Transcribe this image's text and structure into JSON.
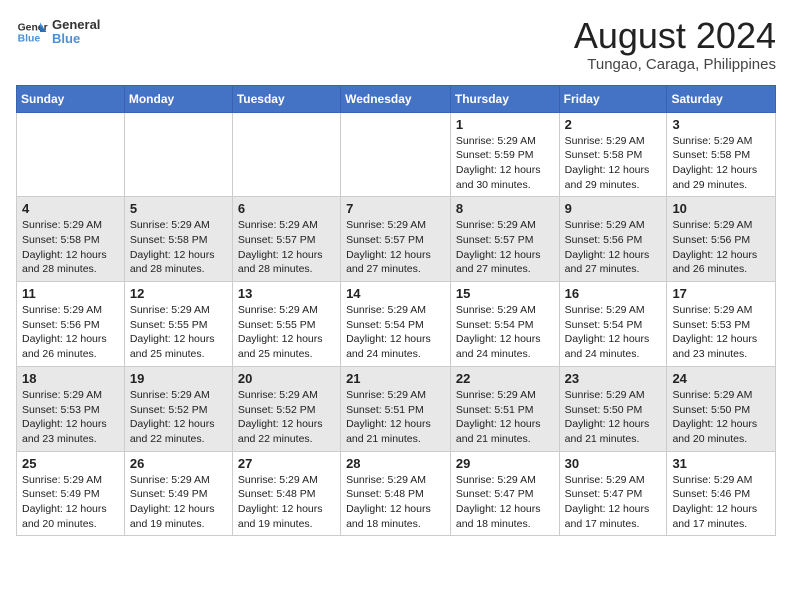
{
  "header": {
    "logo_general": "General",
    "logo_blue": "Blue",
    "title": "August 2024",
    "subtitle": "Tungao, Caraga, Philippines"
  },
  "weekdays": [
    "Sunday",
    "Monday",
    "Tuesday",
    "Wednesday",
    "Thursday",
    "Friday",
    "Saturday"
  ],
  "weeks": [
    [
      {
        "day": "",
        "info": ""
      },
      {
        "day": "",
        "info": ""
      },
      {
        "day": "",
        "info": ""
      },
      {
        "day": "",
        "info": ""
      },
      {
        "day": "1",
        "info": "Sunrise: 5:29 AM\nSunset: 5:59 PM\nDaylight: 12 hours and 30 minutes."
      },
      {
        "day": "2",
        "info": "Sunrise: 5:29 AM\nSunset: 5:58 PM\nDaylight: 12 hours and 29 minutes."
      },
      {
        "day": "3",
        "info": "Sunrise: 5:29 AM\nSunset: 5:58 PM\nDaylight: 12 hours and 29 minutes."
      }
    ],
    [
      {
        "day": "4",
        "info": "Sunrise: 5:29 AM\nSunset: 5:58 PM\nDaylight: 12 hours and 28 minutes."
      },
      {
        "day": "5",
        "info": "Sunrise: 5:29 AM\nSunset: 5:58 PM\nDaylight: 12 hours and 28 minutes."
      },
      {
        "day": "6",
        "info": "Sunrise: 5:29 AM\nSunset: 5:57 PM\nDaylight: 12 hours and 28 minutes."
      },
      {
        "day": "7",
        "info": "Sunrise: 5:29 AM\nSunset: 5:57 PM\nDaylight: 12 hours and 27 minutes."
      },
      {
        "day": "8",
        "info": "Sunrise: 5:29 AM\nSunset: 5:57 PM\nDaylight: 12 hours and 27 minutes."
      },
      {
        "day": "9",
        "info": "Sunrise: 5:29 AM\nSunset: 5:56 PM\nDaylight: 12 hours and 27 minutes."
      },
      {
        "day": "10",
        "info": "Sunrise: 5:29 AM\nSunset: 5:56 PM\nDaylight: 12 hours and 26 minutes."
      }
    ],
    [
      {
        "day": "11",
        "info": "Sunrise: 5:29 AM\nSunset: 5:56 PM\nDaylight: 12 hours and 26 minutes."
      },
      {
        "day": "12",
        "info": "Sunrise: 5:29 AM\nSunset: 5:55 PM\nDaylight: 12 hours and 25 minutes."
      },
      {
        "day": "13",
        "info": "Sunrise: 5:29 AM\nSunset: 5:55 PM\nDaylight: 12 hours and 25 minutes."
      },
      {
        "day": "14",
        "info": "Sunrise: 5:29 AM\nSunset: 5:54 PM\nDaylight: 12 hours and 24 minutes."
      },
      {
        "day": "15",
        "info": "Sunrise: 5:29 AM\nSunset: 5:54 PM\nDaylight: 12 hours and 24 minutes."
      },
      {
        "day": "16",
        "info": "Sunrise: 5:29 AM\nSunset: 5:54 PM\nDaylight: 12 hours and 24 minutes."
      },
      {
        "day": "17",
        "info": "Sunrise: 5:29 AM\nSunset: 5:53 PM\nDaylight: 12 hours and 23 minutes."
      }
    ],
    [
      {
        "day": "18",
        "info": "Sunrise: 5:29 AM\nSunset: 5:53 PM\nDaylight: 12 hours and 23 minutes."
      },
      {
        "day": "19",
        "info": "Sunrise: 5:29 AM\nSunset: 5:52 PM\nDaylight: 12 hours and 22 minutes."
      },
      {
        "day": "20",
        "info": "Sunrise: 5:29 AM\nSunset: 5:52 PM\nDaylight: 12 hours and 22 minutes."
      },
      {
        "day": "21",
        "info": "Sunrise: 5:29 AM\nSunset: 5:51 PM\nDaylight: 12 hours and 21 minutes."
      },
      {
        "day": "22",
        "info": "Sunrise: 5:29 AM\nSunset: 5:51 PM\nDaylight: 12 hours and 21 minutes."
      },
      {
        "day": "23",
        "info": "Sunrise: 5:29 AM\nSunset: 5:50 PM\nDaylight: 12 hours and 21 minutes."
      },
      {
        "day": "24",
        "info": "Sunrise: 5:29 AM\nSunset: 5:50 PM\nDaylight: 12 hours and 20 minutes."
      }
    ],
    [
      {
        "day": "25",
        "info": "Sunrise: 5:29 AM\nSunset: 5:49 PM\nDaylight: 12 hours and 20 minutes."
      },
      {
        "day": "26",
        "info": "Sunrise: 5:29 AM\nSunset: 5:49 PM\nDaylight: 12 hours and 19 minutes."
      },
      {
        "day": "27",
        "info": "Sunrise: 5:29 AM\nSunset: 5:48 PM\nDaylight: 12 hours and 19 minutes."
      },
      {
        "day": "28",
        "info": "Sunrise: 5:29 AM\nSunset: 5:48 PM\nDaylight: 12 hours and 18 minutes."
      },
      {
        "day": "29",
        "info": "Sunrise: 5:29 AM\nSunset: 5:47 PM\nDaylight: 12 hours and 18 minutes."
      },
      {
        "day": "30",
        "info": "Sunrise: 5:29 AM\nSunset: 5:47 PM\nDaylight: 12 hours and 17 minutes."
      },
      {
        "day": "31",
        "info": "Sunrise: 5:29 AM\nSunset: 5:46 PM\nDaylight: 12 hours and 17 minutes."
      }
    ]
  ]
}
